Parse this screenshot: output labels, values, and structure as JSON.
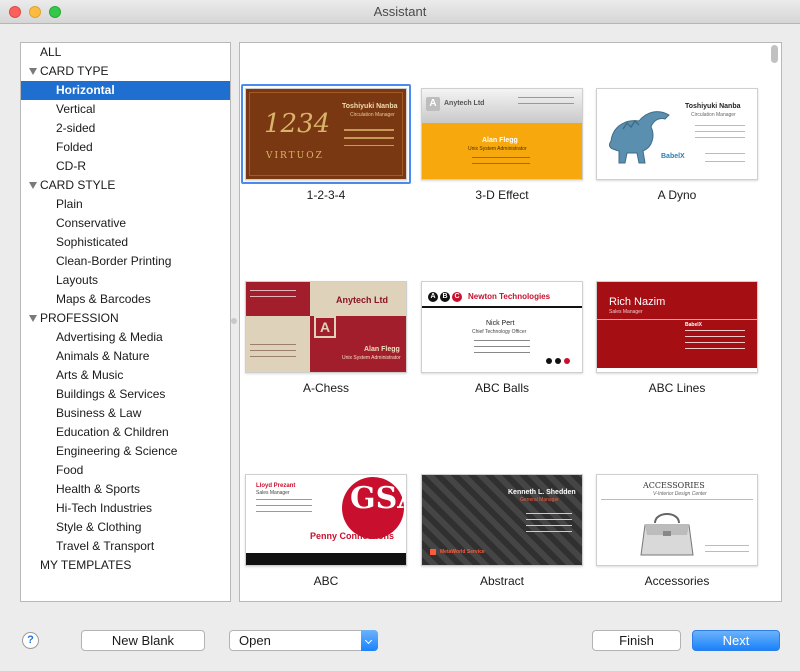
{
  "window": {
    "title": "Assistant"
  },
  "sidebar": {
    "items": [
      {
        "label": "ALL",
        "level": 0
      },
      {
        "label": "CARD TYPE",
        "level": 0,
        "expanded": true
      },
      {
        "label": "Horizontal",
        "level": 1,
        "selected": true
      },
      {
        "label": "Vertical",
        "level": 1
      },
      {
        "label": "2-sided",
        "level": 1
      },
      {
        "label": "Folded",
        "level": 1
      },
      {
        "label": "CD-R",
        "level": 1
      },
      {
        "label": "CARD STYLE",
        "level": 0,
        "expanded": true
      },
      {
        "label": "Plain",
        "level": 1
      },
      {
        "label": "Conservative",
        "level": 1
      },
      {
        "label": "Sophisticated",
        "level": 1
      },
      {
        "label": "Clean-Border Printing",
        "level": 1
      },
      {
        "label": "Layouts",
        "level": 1
      },
      {
        "label": "Maps & Barcodes",
        "level": 1
      },
      {
        "label": "PROFESSION",
        "level": 0,
        "expanded": true
      },
      {
        "label": "Advertising & Media",
        "level": 1
      },
      {
        "label": "Animals & Nature",
        "level": 1
      },
      {
        "label": "Arts & Music",
        "level": 1
      },
      {
        "label": "Buildings & Services",
        "level": 1
      },
      {
        "label": "Business & Law",
        "level": 1
      },
      {
        "label": "Education & Children",
        "level": 1
      },
      {
        "label": "Engineering & Science",
        "level": 1
      },
      {
        "label": "Food",
        "level": 1
      },
      {
        "label": "Health & Sports",
        "level": 1
      },
      {
        "label": "Hi-Tech Industries",
        "level": 1
      },
      {
        "label": "Style & Clothing",
        "level": 1
      },
      {
        "label": "Travel & Transport",
        "level": 1
      },
      {
        "label": "MY TEMPLATES",
        "level": 0
      }
    ]
  },
  "gallery": {
    "templates": [
      {
        "name": "1-2-3-4",
        "selected": true
      },
      {
        "name": "3-D Effect"
      },
      {
        "name": "A Dyno"
      },
      {
        "name": "A-Chess"
      },
      {
        "name": "ABC Balls"
      },
      {
        "name": "ABC Lines"
      },
      {
        "name": "ABC"
      },
      {
        "name": "Abstract"
      },
      {
        "name": "Accessories"
      }
    ],
    "cards": {
      "c1": {
        "name": "Toshiyuki Nanba",
        "title": "Circulation Manager",
        "brand": "VIRTUOZ",
        "mark": "1234"
      },
      "c2": {
        "company": "Anytech Ltd",
        "name": "Alan Flegg",
        "title": "Unix System Administrator"
      },
      "c3": {
        "name": "Toshiyuki Nanba",
        "title": "Circulation Manager",
        "brand": "BabelX"
      },
      "c4": {
        "company": "Anytech Ltd",
        "letter": "A",
        "name": "Alan Flegg",
        "title": "Unix System Administrator"
      },
      "c5": {
        "balls": [
          "A",
          "B",
          "C"
        ],
        "company": "Newton Technologies",
        "name": "Nick Pert",
        "title": "Chief Technology Officer"
      },
      "c6": {
        "name": "Rich Nazim",
        "title": "Sales Manager",
        "brand": "BabelX"
      },
      "c7": {
        "name": "Lloyd Prezant",
        "title": "Sales Manager",
        "company": "Penny Connections"
      },
      "c8": {
        "name": "Kenneth L. Shedden",
        "title": "General Manager",
        "company": "MetaWorld Service"
      },
      "c9": {
        "title": "ACCESSORIES",
        "subtitle": "V-Interior Design Center"
      }
    }
  },
  "footer": {
    "help_label": "?",
    "new_blank_label": "New Blank",
    "open_select_value": "Open",
    "finish_label": "Finish",
    "next_label": "Next"
  },
  "colors": {
    "accent": "#1f6fd0",
    "primary_button": "#1a82fb"
  }
}
